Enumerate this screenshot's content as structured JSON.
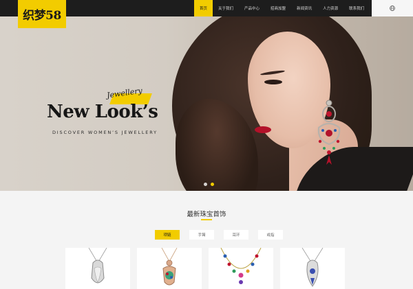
{
  "header": {
    "logo_text": "织梦58",
    "nav": [
      "首页",
      "关于我们",
      "产品中心",
      "招商加盟",
      "新闻资讯",
      "人力资源",
      "联系我们"
    ],
    "active_index": 0,
    "lang_icon": "globe-icon"
  },
  "hero": {
    "script_text": "Jewellery",
    "headline": "New Look’s",
    "subline": "DISCOVER WOMEN’S JEWELLERY",
    "slide_count": 2,
    "active_slide": 1
  },
  "section": {
    "title": "最新珠宝首饰",
    "tabs": [
      "项链",
      "手镯",
      "耳环",
      "戒指"
    ],
    "active_tab": 0
  },
  "products": [
    {
      "icon": "silver-pendant-image"
    },
    {
      "icon": "rose-gold-pendant-image"
    },
    {
      "icon": "gemstone-necklace-image"
    },
    {
      "icon": "silver-necklace-image"
    }
  ],
  "colors": {
    "accent": "#f2cc00",
    "header_bg": "#1d1d1d",
    "page_bg": "#f4f4f4"
  }
}
